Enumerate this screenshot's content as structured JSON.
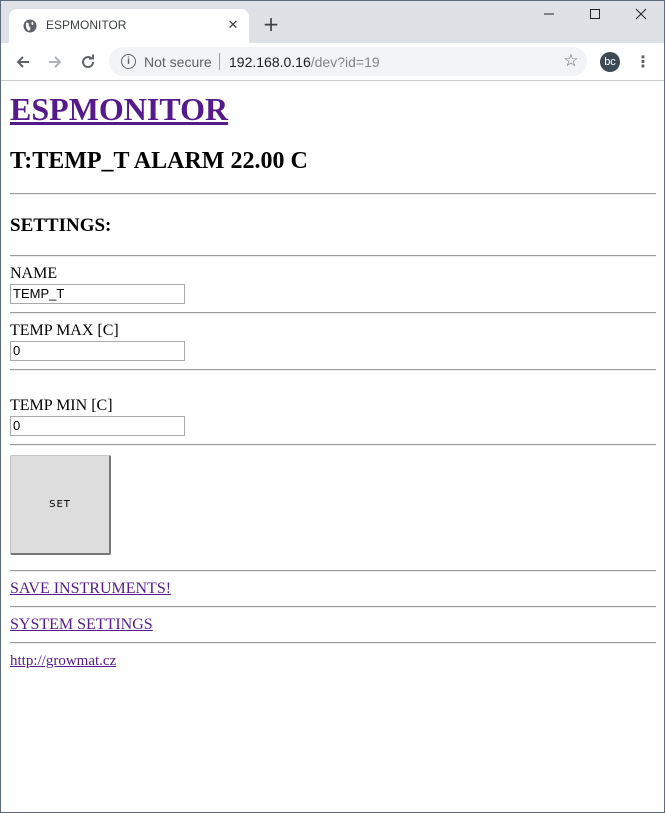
{
  "browser": {
    "tab_title": "ESPMONITOR",
    "security_label": "Not secure",
    "url_host": "192.168.0.16",
    "url_path": "/dev?id=19",
    "profile_initials": "bc"
  },
  "page": {
    "heading": "ESPMONITOR",
    "status": "T:TEMP_T ALARM 22.00 C",
    "settings_heading": "SETTINGS:",
    "fields": {
      "name_label": "NAME",
      "name_value": "TEMP_T",
      "temp_max_label": "TEMP MAX [C]",
      "temp_max_value": "0",
      "temp_min_label": "TEMP MIN [C]",
      "temp_min_value": "0"
    },
    "set_button": "SET",
    "links": {
      "save_instruments": "SAVE INSTRUMENTS!",
      "system_settings": "SYSTEM SETTINGS",
      "website": "http://growmat.cz"
    }
  }
}
